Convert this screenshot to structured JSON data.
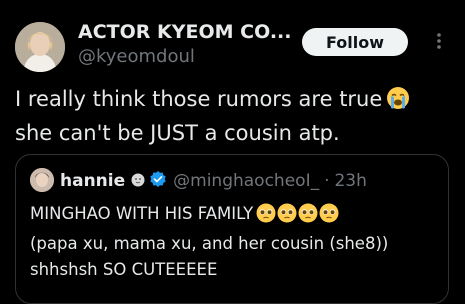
{
  "post": {
    "author": {
      "display_name": "ACTOR KYEOM CO...",
      "handle": "@kyeomdoul"
    },
    "follow_label": "Follow",
    "text_lines": [
      "I really think those rumors are true",
      "she can't be JUST a cousin atp."
    ],
    "text_emoji": "loudly-crying-face"
  },
  "quote": {
    "author_name": "hannie",
    "handle": "@minghaocheoI_",
    "separator": "·",
    "time": "23h",
    "text_lines": [
      "MINGHAO WITH HIS FAMILY",
      "(papa xu, mama xu, and her cousin (she8))",
      "shhshsh SO CUTEEEEE"
    ],
    "line1_emoji": "pleading-face",
    "line1_emoji_count": 4,
    "verified_color": "#1d9bf0"
  },
  "colors": {
    "background": "#000000",
    "text_primary": "#e7e9ea",
    "text_secondary": "#71767b",
    "border": "#2f3336",
    "follow_bg": "#eff3f4",
    "follow_text": "#0f1419"
  }
}
